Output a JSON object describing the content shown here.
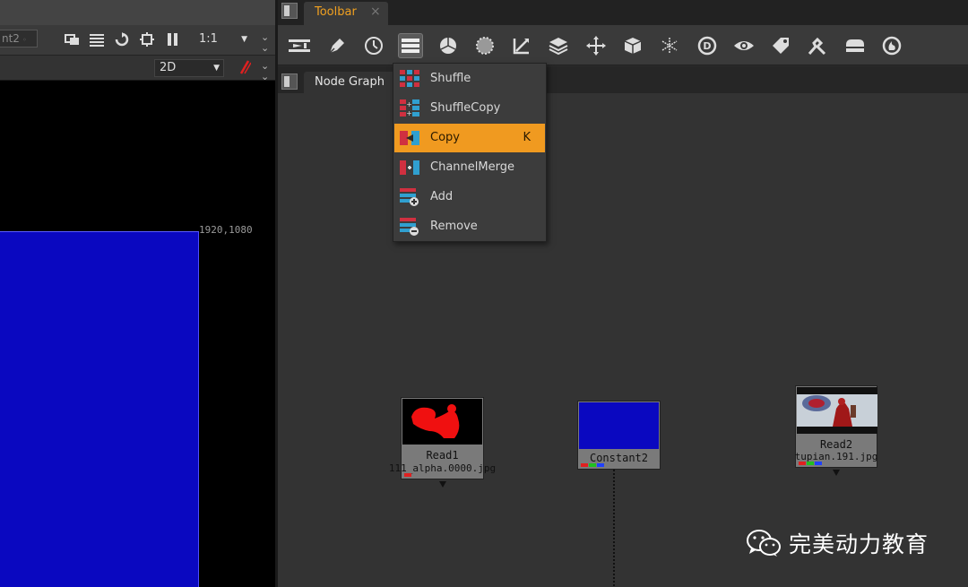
{
  "viewer": {
    "tab_label": "nt2",
    "zoom_value": "1:1",
    "view_mode": "2D",
    "format_label": "1920,1080",
    "colors": {
      "plate": "#0a08c0"
    }
  },
  "panels": {
    "toolbar_tab": "Toolbar",
    "toolbar_tab_close": "×",
    "node_graph_tab": "Node Graph"
  },
  "toolbar_icons": [
    "input-output-icon",
    "draw-icon",
    "time-icon",
    "channel-icon",
    "color-icon",
    "filter-icon",
    "keyer-icon",
    "merge-icon",
    "transform-icon",
    "3d-icon",
    "particles-icon",
    "deep-icon",
    "views-icon",
    "metadata-icon",
    "toolsets-icon",
    "other-icon",
    "furnace-icon"
  ],
  "menu": {
    "items": [
      {
        "label": "Shuffle",
        "shortcut": ""
      },
      {
        "label": "ShuffleCopy",
        "shortcut": ""
      },
      {
        "label": "Copy",
        "shortcut": "K"
      },
      {
        "label": "ChannelMerge",
        "shortcut": ""
      },
      {
        "label": "Add",
        "shortcut": ""
      },
      {
        "label": "Remove",
        "shortcut": ""
      }
    ],
    "highlighted_index": 2,
    "highlight_color": "#f09a20"
  },
  "nodes": {
    "read1": {
      "name": "Read1",
      "file": "111_alpha.0000.jpg"
    },
    "constant2": {
      "name": "Constant2"
    },
    "read2": {
      "name": "Read2",
      "file": "tupian.191.jpg"
    }
  },
  "watermark": {
    "text": "完美动力教育"
  }
}
